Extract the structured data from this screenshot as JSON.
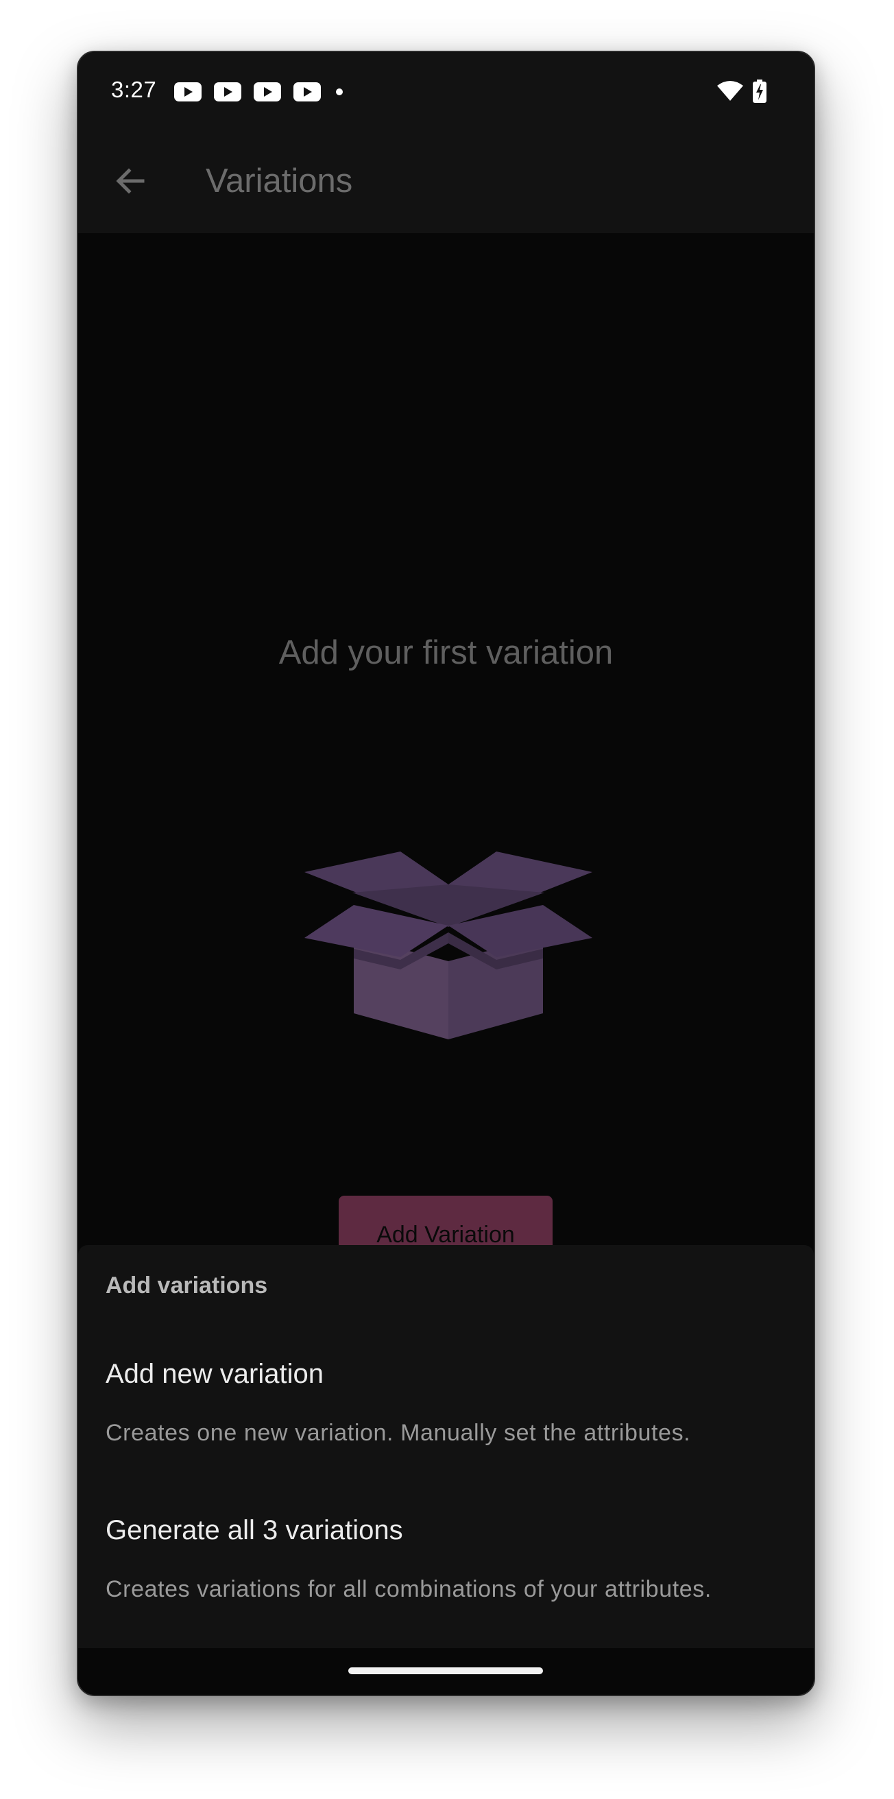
{
  "status_bar": {
    "time": "3:27",
    "left_icons": [
      "youtube-icon",
      "youtube-icon",
      "youtube-icon",
      "youtube-icon",
      "notification-dot-icon"
    ],
    "right_icons": [
      "wifi-icon",
      "battery-charging-icon"
    ]
  },
  "app_bar": {
    "title": "Variations",
    "back_icon": "arrow-back-icon"
  },
  "empty_state": {
    "title": "Add your first variation",
    "illustration": "open-box-icon",
    "button_label": "Add Variation"
  },
  "bottom_sheet": {
    "heading": "Add variations",
    "options": [
      {
        "title": "Add new variation",
        "description": "Creates one new variation. Manually set the attributes."
      },
      {
        "title": "Generate all 3 variations",
        "description": "Creates variations for all combinations of your attributes."
      }
    ]
  },
  "colors": {
    "background": "#070707",
    "surface": "#121212",
    "button": "#5e2a41",
    "illustration": "#4e3a5e"
  }
}
